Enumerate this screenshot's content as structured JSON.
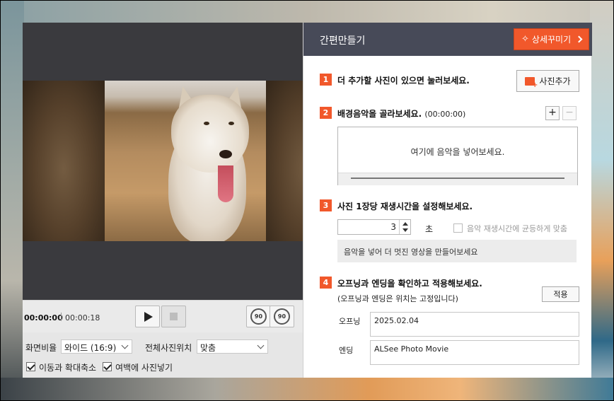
{
  "preview": {
    "current_time": "00:00:00",
    "total_time": "00:00:18",
    "rotate_left_label": "90",
    "rotate_right_label": "90"
  },
  "settings": {
    "ratio_label": "화면비율",
    "ratio_value": "와이드 (16:9)",
    "position_label": "전체사진위치",
    "position_value": "맞춤",
    "checkbox_move_zoom": "이동과 확대축소",
    "checkbox_fill_margin": "여백에 사진넣기"
  },
  "panel": {
    "title": "간편만들기",
    "detail_button": "상세꾸미기"
  },
  "step1": {
    "num": "1",
    "title": "더 추가할 사진이 있으면 눌러보세요.",
    "add_button": "사진추가"
  },
  "step2": {
    "num": "2",
    "title": "배경음악을 골라보세요.",
    "duration": "(00:00:00)",
    "add_label": "+",
    "remove_label": "−",
    "drop_hint": "여기에 음악을 넣어보세요."
  },
  "step3": {
    "num": "3",
    "title": "사진 1장당 재생시간을 설정해보세요.",
    "seconds_value": "3",
    "seconds_unit": "초",
    "sync_checkbox": "음악 재생시간에 균등하게 맞춤",
    "hint": "음악을 넣어 더 멋진 영상을 만들어보세요"
  },
  "step4": {
    "num": "4",
    "title": "오프닝과 엔딩을 확인하고 적용해보세요.",
    "note": "(오프닝과 엔딩은 위치는 고정입니다)",
    "apply_button": "적용",
    "opening_label": "오프닝",
    "opening_value": "2025.02.04",
    "ending_label": "엔딩",
    "ending_value": "ALSee Photo Movie"
  },
  "colors": {
    "accent": "#f1582b",
    "header_bg": "#474a58",
    "preview_bg": "#3a3a3e"
  }
}
